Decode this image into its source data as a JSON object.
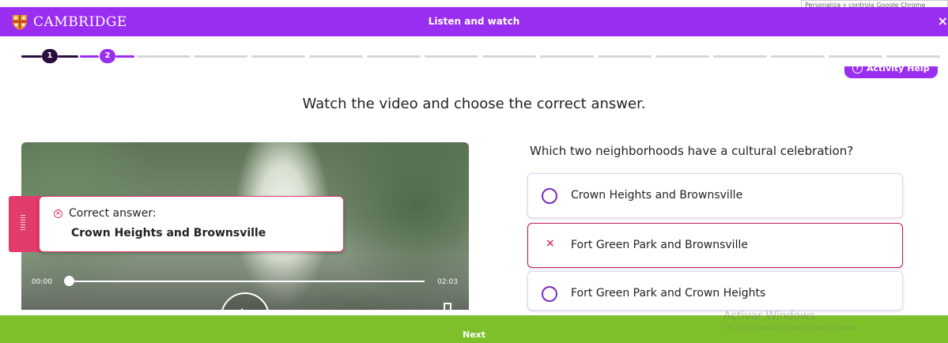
{
  "header": {
    "brand": "CAMBRIDGE",
    "title": "Listen and watch",
    "chrome_hint": "Personaliza y controla Google Chrome",
    "close_label": "×"
  },
  "progress": {
    "steps": [
      "1",
      "2"
    ],
    "current_step": 2,
    "total_segments": 16
  },
  "help": {
    "label": "Activity Help",
    "icon": "?"
  },
  "instruction": "Watch the video and choose the correct answer.",
  "video": {
    "time_current": "00:00",
    "time_total": "02:03",
    "progress_fraction": 0.0
  },
  "feedback": {
    "label": "Correct answer:",
    "answer": "Crown Heights and Brownsville",
    "icon": "⊗"
  },
  "question": {
    "text": "Which two neighborhoods have a cultural celebration?",
    "options": [
      {
        "label": "Crown Heights and Brownsville",
        "state": "unselected"
      },
      {
        "label": "Fort Green Park and Brownsville",
        "state": "wrong"
      },
      {
        "label": "Fort Green Park and Crown Heights",
        "state": "unselected"
      }
    ],
    "wrong_mark": "×"
  },
  "watermark": {
    "line1": "Activar Windows",
    "line2": "Ve a Configuración para activar Windows."
  },
  "footer": {
    "next_label": "Next"
  },
  "colors": {
    "brand_purple": "#9a2ef0",
    "dark_step": "#2b0c3f",
    "wrong_pink": "#e23c6a",
    "footer_green": "#7ec02a"
  }
}
